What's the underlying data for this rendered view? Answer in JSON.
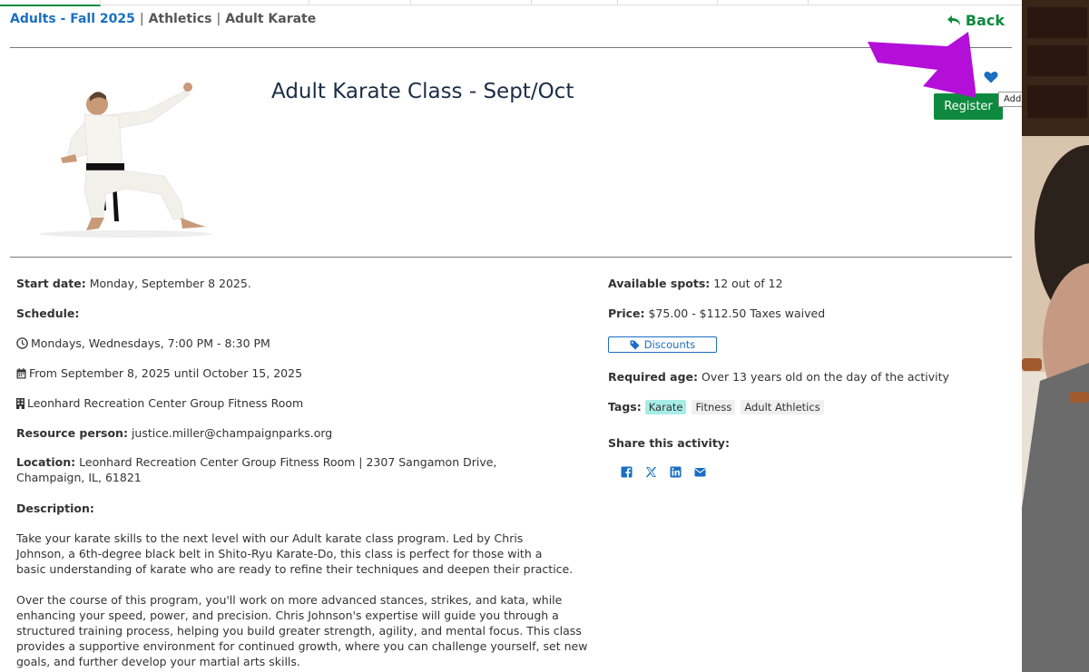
{
  "breadcrumb": {
    "item1": "Adults - Fall 2025",
    "item2": "Athletics",
    "item3": "Adult Karate",
    "separator": "|"
  },
  "back_label": "Back",
  "title": "Adult Karate Class - Sept/Oct",
  "wishlist_tooltip": "Add to wish list",
  "register_label": "Register",
  "details": {
    "start_label": "Start date:",
    "start_value": "Monday, September 8 2025.",
    "schedule_label": "Schedule:",
    "schedule_days": "Mondays, Wednesdays, 7:00 PM - 8:30 PM",
    "schedule_dates": "From September 8, 2025 until October 15, 2025",
    "schedule_place": "Leonhard Recreation Center Group Fitness Room",
    "resource_label": "Resource person:",
    "resource_value": "justice.miller@champaignparks.org",
    "location_label": "Location:",
    "location_value": "Leonhard Recreation Center Group Fitness Room | 2307 Sangamon Drive, Champaign, IL, 61821",
    "description_label": "Description:",
    "description_p1": "Take your karate skills to the next level with our Adult karate class program. Led by Chris Johnson, a 6th-degree black belt in Shito-Ryu Karate-Do, this class is perfect for those with a basic understanding of karate who are ready to refine their techniques and deepen their practice.",
    "description_p2": "Over the course of this program, you'll work on more advanced stances, strikes, and kata, while enhancing your speed, power, and precision. Chris Johnson's expertise will guide you through a structured training process, helping you build greater strength, agility, and mental focus. This class provides a supportive environment for continued growth, where you can challenge yourself, set new goals, and further develop your martial arts skills."
  },
  "info": {
    "spots_label": "Available spots:",
    "spots_value": "12 out of 12",
    "price_label": "Price:",
    "price_value": "$75.00 - $112.50 Taxes waived",
    "discounts_label": "Discounts",
    "age_label": "Required age:",
    "age_value": "Over 13 years old on the day of the activity",
    "tags_label": "Tags:",
    "tags": [
      "Karate",
      "Fitness",
      "Adult Athletics"
    ],
    "share_label": "Share this activity:"
  },
  "colors": {
    "accent_green": "#0e8a3e",
    "link_blue": "#1a6fc2",
    "title_navy": "#1b2e45",
    "annotation_arrow": "#b40fd8",
    "tag_highlight": "#a7ede7"
  },
  "icons": {
    "back": "undo-arrow-icon",
    "wishlist": "heart-icon",
    "share": [
      "facebook-icon",
      "x-icon",
      "linkedin-icon",
      "email-icon"
    ]
  }
}
